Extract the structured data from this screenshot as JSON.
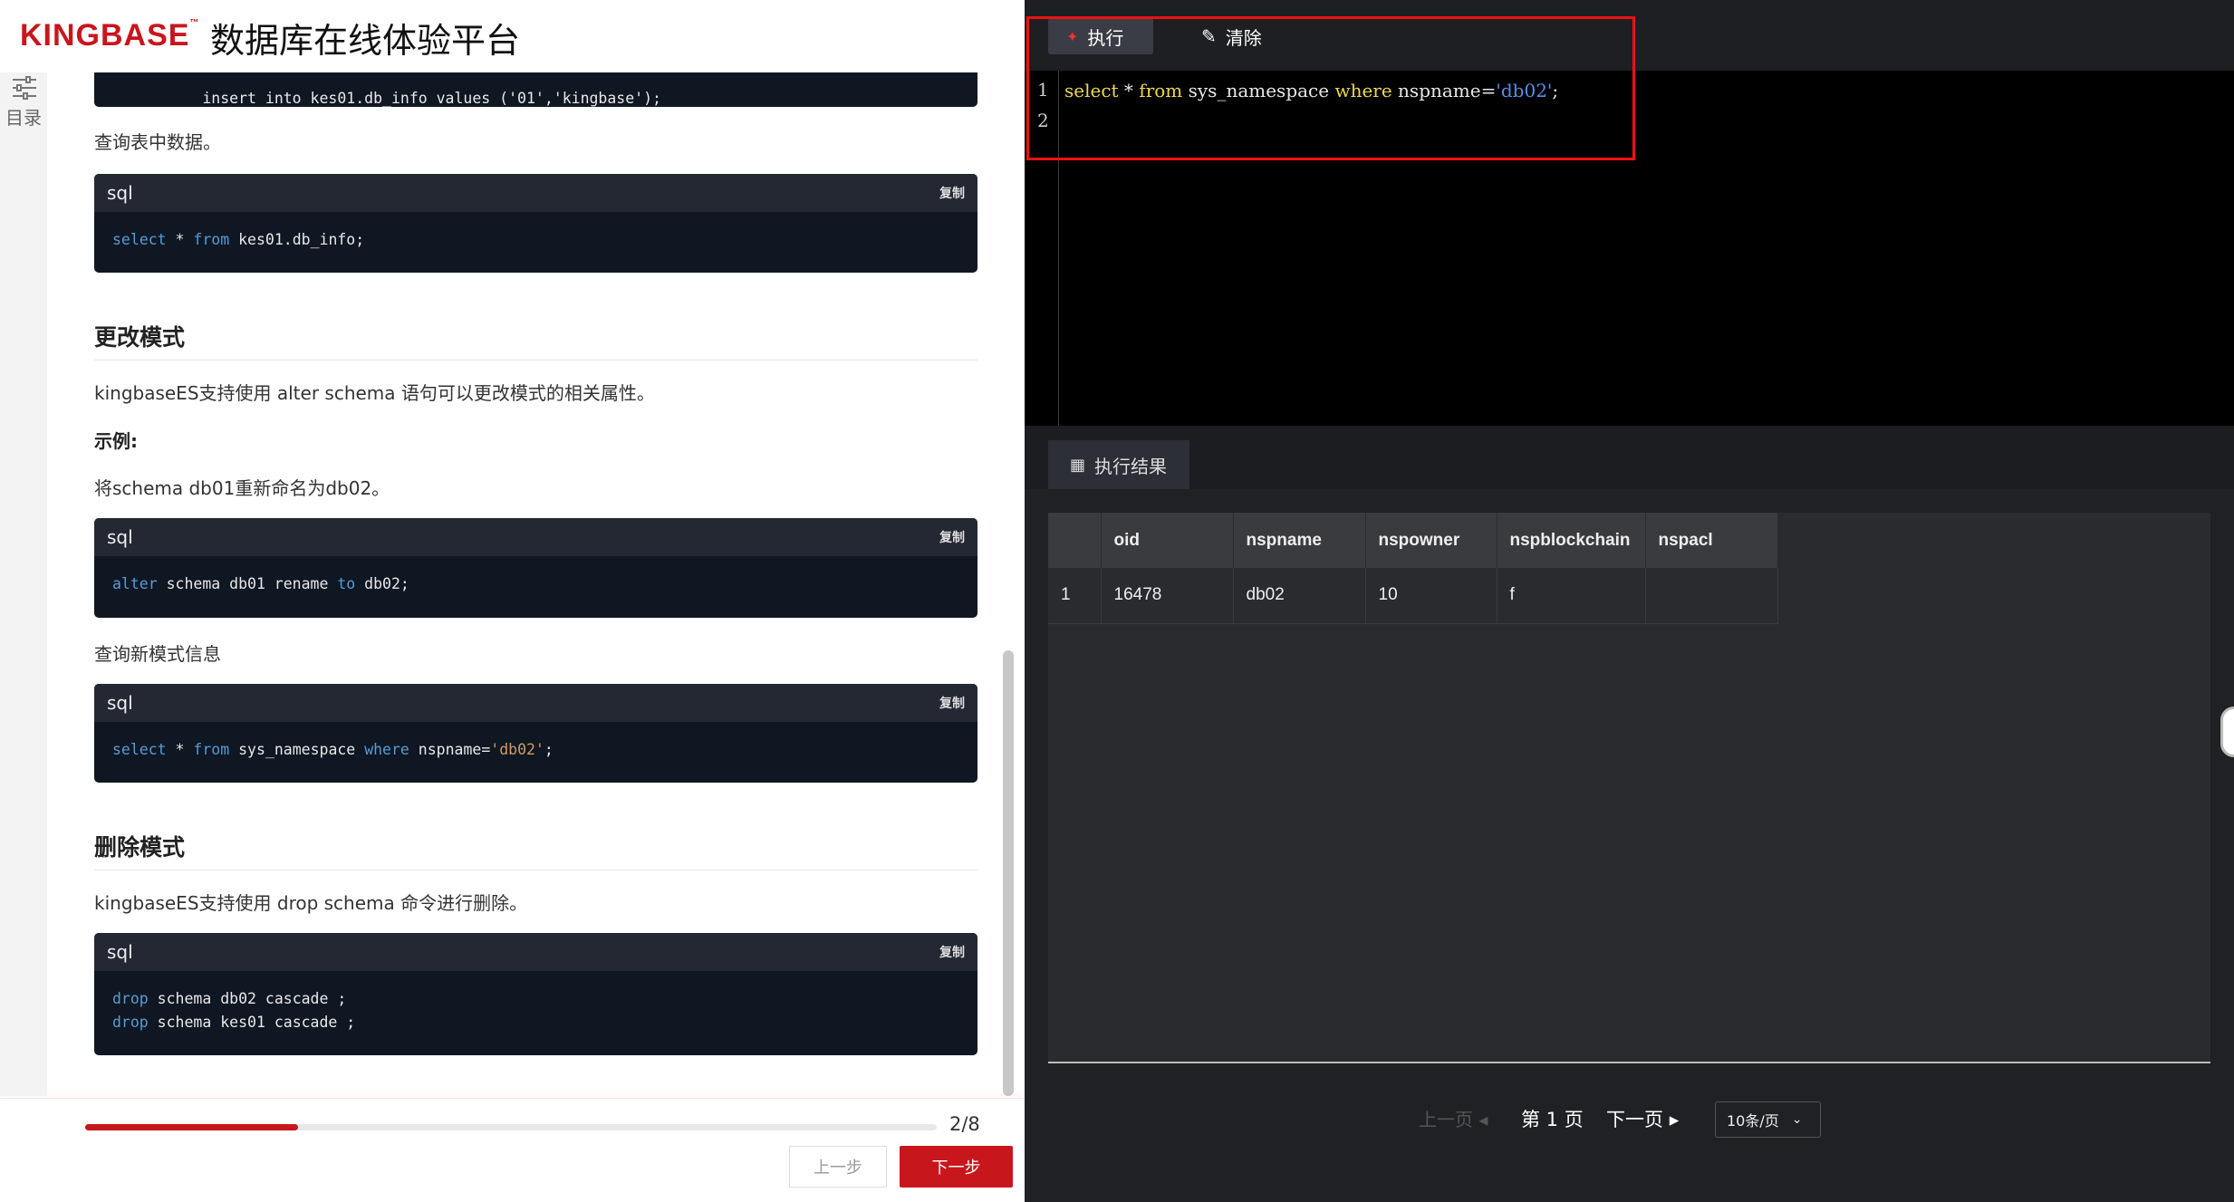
{
  "header": {
    "logo_text": "KINGBASE",
    "logo_tm": "™",
    "site_title": "数据库在线体验平台"
  },
  "toc": {
    "label": "目录",
    "icon": "sliders-icon"
  },
  "doc": {
    "top_code_line": "insert into kes01.db_info values ('01','kingbase');",
    "para_query_table": "查询表中数据。",
    "copy_label": "复制",
    "lang_label": "sql",
    "block_select_table": {
      "kw1": "select",
      "mid": " * ",
      "kw2": "from",
      "rest": " kes01.db_info;"
    },
    "h_alter": "更改模式",
    "para_alter_desc": "kingbaseES支持使用 alter schema 语句可以更改模式的相关属性。",
    "example_label": "示例:",
    "para_rename": "将schema db01重新命名为db02。",
    "block_alter": {
      "kw1": "alter",
      "mid": " schema db01 rename ",
      "kw2": "to",
      "rest": " db02;"
    },
    "para_query_schema": "查询新模式信息",
    "block_select_ns": {
      "kw1": "select",
      "mid": " * ",
      "kw2": "from",
      "mid2": " sys_namespace ",
      "kw3": "where",
      "mid3": " nspname=",
      "str": "'db02'",
      "rest": ";"
    },
    "h_drop": "删除模式",
    "para_drop_desc": "kingbaseES支持使用 drop schema 命令进行删除。",
    "block_drop": {
      "line1": {
        "kw": "drop",
        "rest": " schema db02 cascade ;"
      },
      "line2": {
        "kw": "drop",
        "rest": " schema kes01 cascade ;"
      }
    }
  },
  "progress": {
    "current": 2,
    "total": 8,
    "text": "2/8",
    "fraction": 0.25
  },
  "nav": {
    "prev_label": "上一步",
    "next_label": "下一步"
  },
  "toolbar": {
    "exec_label": "执行",
    "clear_label": "清除"
  },
  "editor": {
    "line_numbers": [
      "1",
      "2"
    ],
    "line1": {
      "kw1": "select",
      "mid": " * ",
      "kw2": "from",
      "mid2": " sys_namespace ",
      "kw3": "where",
      "mid3": " nspname=",
      "str": "'db02'",
      "rest": ";"
    }
  },
  "results": {
    "tab_label": "执行结果",
    "columns": [
      "",
      "oid",
      "nspname",
      "nspowner",
      "nspblockchain",
      "nspacl"
    ],
    "rows": [
      [
        "1",
        "16478",
        "db02",
        "10",
        "f",
        ""
      ]
    ]
  },
  "pager": {
    "prev_label": "上一页",
    "current_label": "第 1 页",
    "next_label": "下一页",
    "page_size_label": "10条/页"
  },
  "colors": {
    "brand_red": "#c8161d",
    "code_bg": "#0f1722",
    "editor_keyword": "#f0d850",
    "editor_string": "#5a8ee8",
    "highlight_border": "#ee1111"
  }
}
